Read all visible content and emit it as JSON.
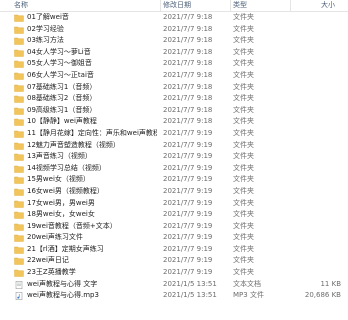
{
  "columns": {
    "name": "名称",
    "date": "修改日期",
    "type": "类型",
    "size": "大小"
  },
  "rows": [
    {
      "name": "01了解wei音",
      "date": "2021/7/7 9:18",
      "type": "文件夹",
      "size": "",
      "icon": "folder-icon"
    },
    {
      "name": "02学习经验",
      "date": "2021/7/7 9:18",
      "type": "文件夹",
      "size": "",
      "icon": "folder-icon"
    },
    {
      "name": "03练习方法",
      "date": "2021/7/7 9:18",
      "type": "文件夹",
      "size": "",
      "icon": "folder-icon"
    },
    {
      "name": "04女人学习～萝Li音",
      "date": "2021/7/7 9:18",
      "type": "文件夹",
      "size": "",
      "icon": "folder-icon"
    },
    {
      "name": "05女人学习～御姐音",
      "date": "2021/7/7 9:18",
      "type": "文件夹",
      "size": "",
      "icon": "folder-icon"
    },
    {
      "name": "06女人学习～正tai音",
      "date": "2021/7/7 9:18",
      "type": "文件夹",
      "size": "",
      "icon": "folder-icon"
    },
    {
      "name": "07基础练习1（音频）",
      "date": "2021/7/7 9:18",
      "type": "文件夹",
      "size": "",
      "icon": "folder-icon"
    },
    {
      "name": "08基础练习2（音频）",
      "date": "2021/7/7 9:18",
      "type": "文件夹",
      "size": "",
      "icon": "folder-icon"
    },
    {
      "name": "09高级练习1（音频）",
      "date": "2021/7/7 9:18",
      "type": "文件夹",
      "size": "",
      "icon": "folder-icon"
    },
    {
      "name": "10【静静】wei声教程",
      "date": "2021/7/7 9:18",
      "type": "文件夹",
      "size": "",
      "icon": "folder-icon"
    },
    {
      "name": "11【静月花嫁】定向性：声乐和wei声教程",
      "date": "2021/7/7 9:19",
      "type": "文件夹",
      "size": "",
      "icon": "folder-icon"
    },
    {
      "name": "12魅力声音塑造教程（视频）",
      "date": "2021/7/7 9:19",
      "type": "文件夹",
      "size": "",
      "icon": "folder-icon"
    },
    {
      "name": "13声音练习（视频）",
      "date": "2021/7/7 9:19",
      "type": "文件夹",
      "size": "",
      "icon": "folder-icon"
    },
    {
      "name": "14视频学习总结（视频）",
      "date": "2021/7/7 9:19",
      "type": "文件夹",
      "size": "",
      "icon": "folder-icon"
    },
    {
      "name": "15男wei女（视频）",
      "date": "2021/7/7 9:19",
      "type": "文件夹",
      "size": "",
      "icon": "folder-icon"
    },
    {
      "name": "16女wei男（视频教程）",
      "date": "2021/7/7 9:19",
      "type": "文件夹",
      "size": "",
      "icon": "folder-icon"
    },
    {
      "name": "17女wei男，男wei男",
      "date": "2021/7/7 9:19",
      "type": "文件夹",
      "size": "",
      "icon": "folder-icon"
    },
    {
      "name": "18男wei女，女wei女",
      "date": "2021/7/7 9:19",
      "type": "文件夹",
      "size": "",
      "icon": "folder-icon"
    },
    {
      "name": "19wei音教程（音频+文本）",
      "date": "2021/7/7 9:19",
      "type": "文件夹",
      "size": "",
      "icon": "folder-icon"
    },
    {
      "name": "20wei声练习文件",
      "date": "2021/7/7 9:19",
      "type": "文件夹",
      "size": "",
      "icon": "folder-icon"
    },
    {
      "name": "21【rl酒】定期女声练习",
      "date": "2021/7/7 9:19",
      "type": "文件夹",
      "size": "",
      "icon": "folder-icon"
    },
    {
      "name": "22wei声日记",
      "date": "2021/7/7 9:19",
      "type": "文件夹",
      "size": "",
      "icon": "folder-icon"
    },
    {
      "name": "23王Z英播教学",
      "date": "2021/7/7 9:19",
      "type": "文件夹",
      "size": "",
      "icon": "folder-icon"
    },
    {
      "name": "wei声教程与心得 文字",
      "date": "2021/1/5 13:51",
      "type": "文本文档",
      "size": "11 KB",
      "icon": "text-document-icon"
    },
    {
      "name": "wei声教程与心得.mp3",
      "date": "2021/1/5 13:51",
      "type": "MP3 文件",
      "size": "20,686 KB",
      "icon": "mp3-file-icon"
    }
  ],
  "colors": {
    "folder": "#f2c55c",
    "folder_dark": "#d9a93a",
    "header_text": "#4c607a"
  }
}
